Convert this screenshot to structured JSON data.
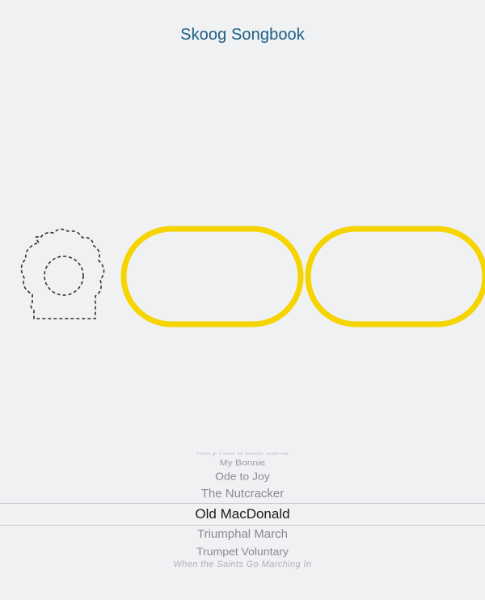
{
  "app": {
    "title": "Skoog Songbook"
  },
  "colors": {
    "title": "#1a5f86",
    "accent_outline": "#f5d400",
    "device_outline": "#333333",
    "background": "#f0f1f3"
  },
  "song_picker": {
    "items": [
      "Mary Had a Little Lamb",
      "My Bonnie",
      "Ode to Joy",
      "The Nutcracker",
      "Old MacDonald",
      "Triumphal March",
      "Trumpet Voluntary",
      "When the Saints Go Marching In"
    ],
    "selected_index": 4,
    "selected": "Old MacDonald"
  }
}
